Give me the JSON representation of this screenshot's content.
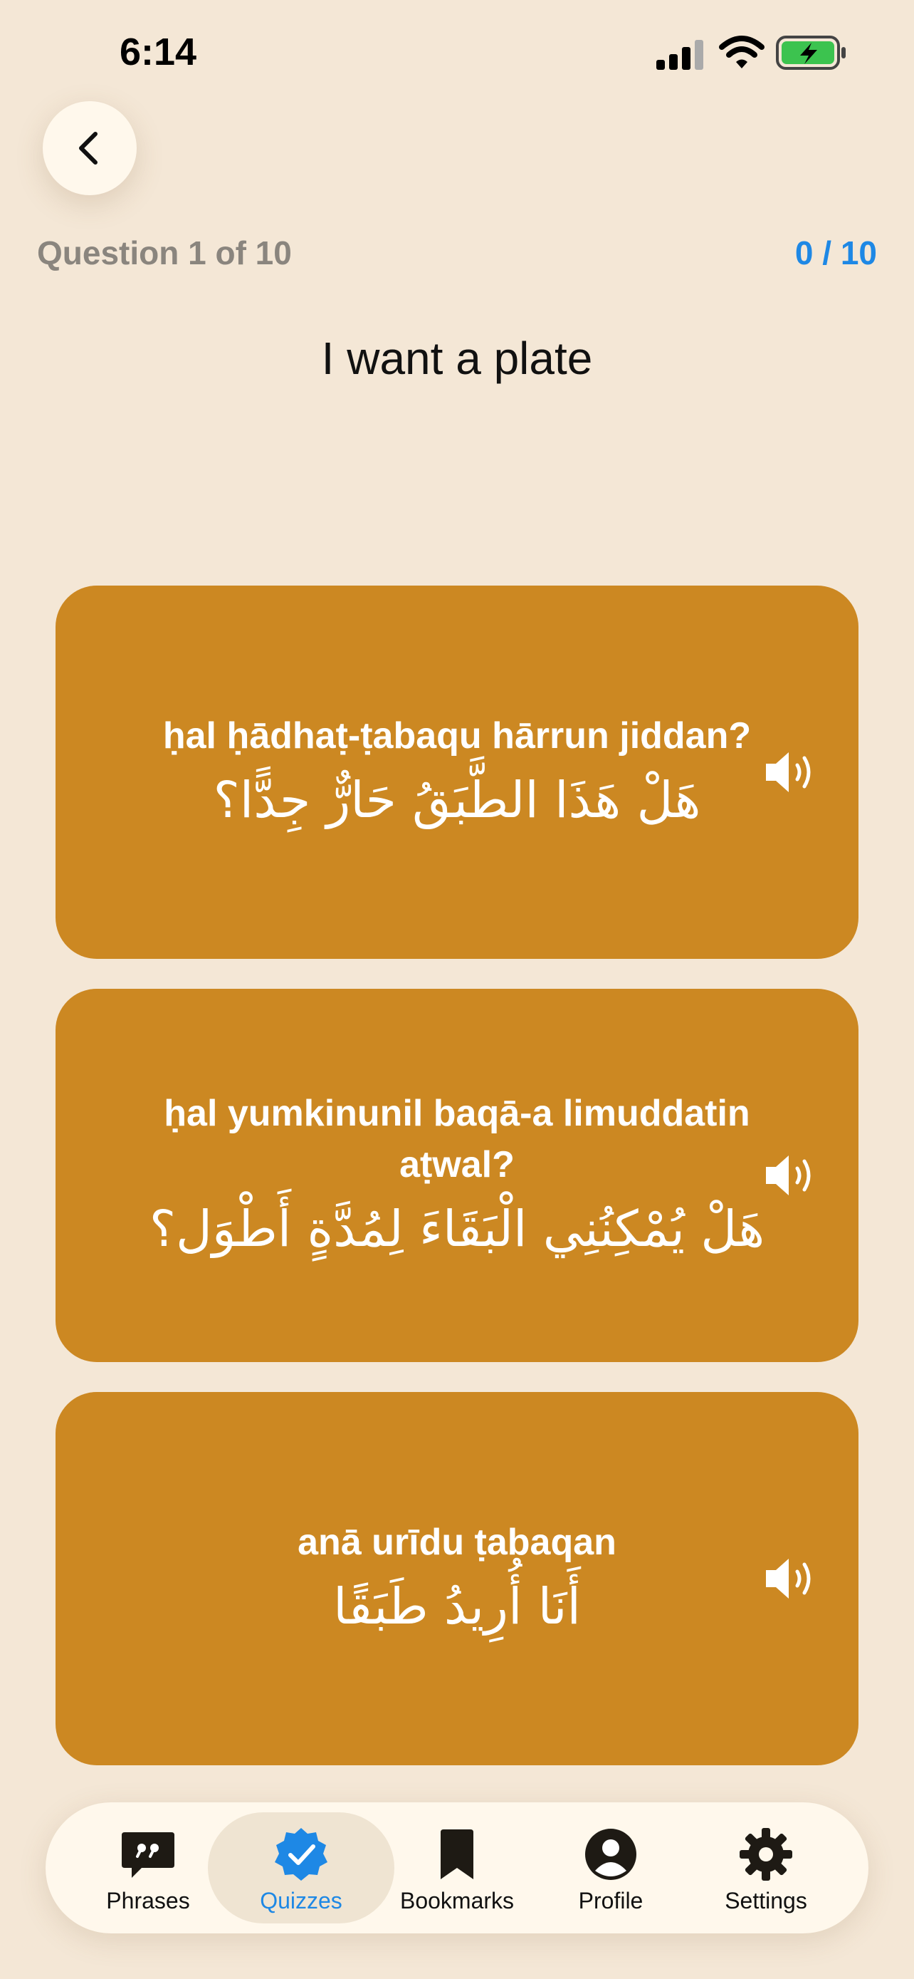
{
  "status_bar": {
    "time": "6:14",
    "icons": [
      "cellular-signal-icon",
      "wifi-icon",
      "battery-charging-icon"
    ]
  },
  "header": {
    "back_icon": "chevron-left-icon",
    "question_counter": "Question 1 of 10",
    "score": "0 / 10"
  },
  "prompt": "I want a plate",
  "options": [
    {
      "transliteration": "ḥal ḥādhaṭ-ṭabaqu hārrun jiddan?",
      "arabic": "هَلْ هَذَا الطَّبَقُ حَارٌّ جِدًّا؟",
      "icon": "speaker-icon"
    },
    {
      "transliteration": "ḥal yumkinunil baqā-a limuddatin aṭwal?",
      "arabic": "هَلْ يُمْكِنُنِي الْبَقَاءَ لِمُدَّةٍ أَطْوَل؟",
      "icon": "speaker-icon"
    },
    {
      "transliteration": "anā urīdu ṭabaqan",
      "arabic": "أَنَا أُرِيدُ طَبَقًا",
      "icon": "speaker-icon"
    }
  ],
  "tab_bar": {
    "active": "Quizzes",
    "tabs": [
      {
        "label": "Phrases",
        "icon": "quote-bubble-icon"
      },
      {
        "label": "Quizzes",
        "icon": "verified-check-icon"
      },
      {
        "label": "Bookmarks",
        "icon": "bookmark-icon"
      },
      {
        "label": "Profile",
        "icon": "person-circle-icon"
      },
      {
        "label": "Settings",
        "icon": "gear-icon"
      }
    ]
  },
  "colors": {
    "background": "#F4E7D6",
    "card": "#CC8822",
    "accent": "#1E88E5",
    "muted_text": "#8A857E"
  }
}
